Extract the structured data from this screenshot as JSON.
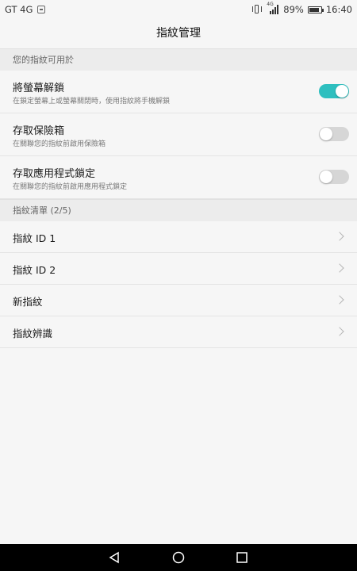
{
  "status_bar": {
    "carrier": "GT 4G",
    "network_label": "4G",
    "battery": "89%",
    "battery_level": 0.89,
    "time": "16:40"
  },
  "header": {
    "title": "指紋管理"
  },
  "sections": [
    {
      "header": "您的指紋可用於"
    },
    {
      "header": "指紋清單 (2/5)"
    }
  ],
  "usage_items": [
    {
      "title": "將螢幕解鎖",
      "subtitle": "在鎖定螢幕上或螢幕關閉時，使用指紋將手機解鎖",
      "enabled": true
    },
    {
      "title": "存取保險箱",
      "subtitle": "在關聯您的指紋前啟用保險箱",
      "enabled": false
    },
    {
      "title": "存取應用程式鎖定",
      "subtitle": "在關聯您的指紋前啟用應用程式鎖定",
      "enabled": false
    }
  ],
  "fingerprint_list": [
    {
      "label": "指紋 ID 1"
    },
    {
      "label": "指紋 ID 2"
    },
    {
      "label": "新指紋"
    },
    {
      "label": "指紋辨識"
    }
  ],
  "colors": {
    "accent": "#2ebfbf",
    "background": "#f6f6f6",
    "section_bg": "#ececec",
    "nav_bar": "#000000"
  }
}
